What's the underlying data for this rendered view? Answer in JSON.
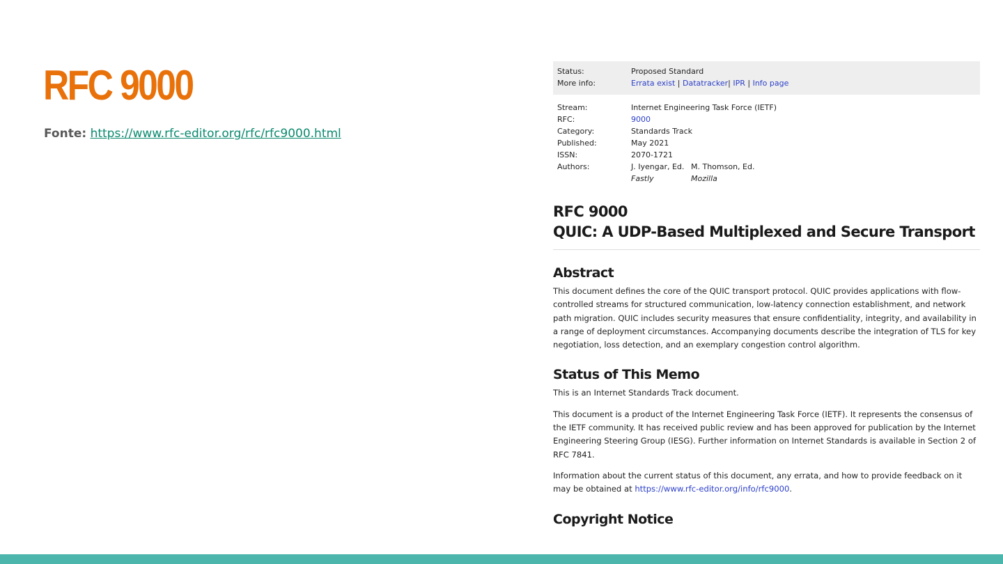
{
  "slide": {
    "title": "RFC 9000",
    "source_label": "Fonte:",
    "source_url": "https://www.rfc-editor.org/rfc/rfc9000.html"
  },
  "rfc": {
    "status": {
      "key": "Status:",
      "value": "Proposed Standard"
    },
    "more_info": {
      "key": "More info:",
      "links": [
        "Errata exist",
        "Datatracker",
        "IPR",
        "Info page"
      ]
    },
    "meta": {
      "stream": {
        "key": "Stream:",
        "value": "Internet Engineering Task Force (IETF)"
      },
      "rfc": {
        "key": "RFC:",
        "value": "9000"
      },
      "category": {
        "key": "Category:",
        "value": "Standards Track"
      },
      "published": {
        "key": "Published:",
        "value": "May 2021"
      },
      "issn": {
        "key": "ISSN:",
        "value": "2070-1721"
      },
      "authors": {
        "key": "Authors:",
        "list": [
          {
            "name": "J. Iyengar, Ed.",
            "org": "Fastly"
          },
          {
            "name": "M. Thomson, Ed.",
            "org": "Mozilla"
          }
        ]
      }
    },
    "doc_number": "RFC 9000",
    "doc_title": "QUIC: A UDP-Based Multiplexed and Secure Transport",
    "abstract": {
      "heading": "Abstract",
      "text": "This document defines the core of the QUIC transport protocol. QUIC provides applications with flow-controlled streams for structured communication, low-latency connection establishment, and network path migration. QUIC includes security measures that ensure confidentiality, integrity, and availability in a range of deployment circumstances. Accompanying documents describe the integration of TLS for key negotiation, loss detection, and an exemplary congestion control algorithm."
    },
    "status_memo": {
      "heading": "Status of This Memo",
      "p1": "This is an Internet Standards Track document.",
      "p2": "This document is a product of the Internet Engineering Task Force (IETF). It represents the consensus of the IETF community. It has received public review and has been approved for publication by the Internet Engineering Steering Group (IESG). Further information on Internet Standards is available in Section 2 of RFC 7841.",
      "p3_text": "Information about the current status of this document, any errata, and how to provide feedback on it may be obtained at",
      "p3_link": "https://www.rfc-editor.org/info/rfc9000",
      "p3_end": "."
    },
    "copyright": {
      "heading": "Copyright Notice"
    }
  },
  "colors": {
    "title": "#e8710a",
    "link": "#2b3fc8",
    "bottom_bar": "#4db6ac",
    "source_link": "#0b8a6f"
  }
}
